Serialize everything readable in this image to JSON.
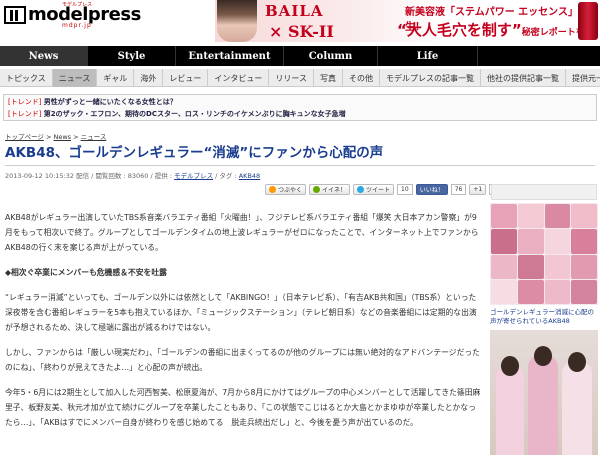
{
  "header": {
    "logo_text": "modelpress",
    "logo_kana": "モデルプレス",
    "logo_url_text": "mdpr.jp",
    "banner": {
      "brand": "BAILA",
      "brand2": "× SK-II",
      "line1": "新美容液「ステムパワー エッセンス」誕生！",
      "line2": "“大人毛穴を制す”",
      "line2_small": "秘密レポートを公開中！"
    }
  },
  "main_nav": [
    "News",
    "Style",
    "Entertainment",
    "Column",
    "Life"
  ],
  "main_nav_active": 0,
  "sub_nav": [
    "トピックス",
    "ニュース",
    "ギャル",
    "海外",
    "レビュー",
    "インタビュー",
    "リリース",
    "写真",
    "その他",
    "モデルプレスの記事一覧",
    "他社の提供記事一覧",
    "提供元一覧"
  ],
  "sub_nav_active": 1,
  "trend": [
    {
      "tag": "[トレンド]",
      "text": "男性がずっと一緒にいたくなる女性とは？"
    },
    {
      "tag": "[トレンド]",
      "text": "第2のザック・エフロン、期待のDCスター、ロス・リンチのイケメンぶりに胸キュンな女子急増"
    }
  ],
  "breadcrumb": {
    "home": "トップページ",
    "sep1": " > ",
    "news": "News",
    "sep2": " > ",
    "current": "ニュース"
  },
  "title": "AKB48、ゴールデンレギュラー“消滅”にファンから心配の声",
  "meta": {
    "datetime": "2013-09-12 10:15:32 配信",
    "views": " / 閲覧回数 : 83060 / 提供 : ",
    "provider": "モデルプレス",
    "tag_label": " / タグ : ",
    "tag": "AKB48"
  },
  "social": {
    "tsubuyaku": "つぶやく",
    "iine": "イイネ！",
    "tweet": "ツイート",
    "tweet_count": "10",
    "like": "いいね！",
    "like_count": "76",
    "gplus": "+1",
    "gplus_count": "0"
  },
  "article": {
    "p1": "AKB48がレギュラー出演していたTBS系音楽バラエティ番組「火曜曲！」、フジテレビ系バラエティ番組「爆笑 大日本アカン警察」が9月をもって相次いで終了。グループとしてゴールデンタイムの地上波レギュラーがゼロになったことで、インターネット上でファンからAKB48の行く末を案じる声が上がっている。",
    "subhead": "◆相次ぐ卒業にメンバーも危機感＆不安を吐露",
    "p2": "“レギュラー消滅”といっても、ゴールデン以外には依然として「AKBINGO！」（日本テレビ系）、「有吉AKB共和国」（TBS系）といった深夜帯を含む番組レギュラーを5本も抱えているほか、「ミュージックステーション」（テレビ朝日系）などの音楽番組には定期的な出演が予想されるため、決して極端に露出が減るわけではない。",
    "p3": "しかし、ファンからは「厳しい現実だわ」、「ゴールデンの番組に出まくってるのが他のグループには無い絶対的なアドバンテージだったのにね」、「終わりが見えてきたよ…」と心配の声が続出。",
    "p4": "今年5・6月には2期生として加入した河西智美、松原夏海が、7月から8月にかけてはグループの中心メンバーとして活躍してきた篠田麻里子、板野友美、秋元才加が立て続けにグループを卒業したこともあり、「この状態でこじはるとか大島とかまゆゆが卒業したとかなったら…」、「AKBはすでにメンバー自身が終わりを感じ始めてる　脱走兵続出だし」と、今後を憂う声が出ているのだ。"
  },
  "sidebar": {
    "caption": "ゴールデンレギュラー消滅に心配の声が寄せられているAKB48"
  }
}
